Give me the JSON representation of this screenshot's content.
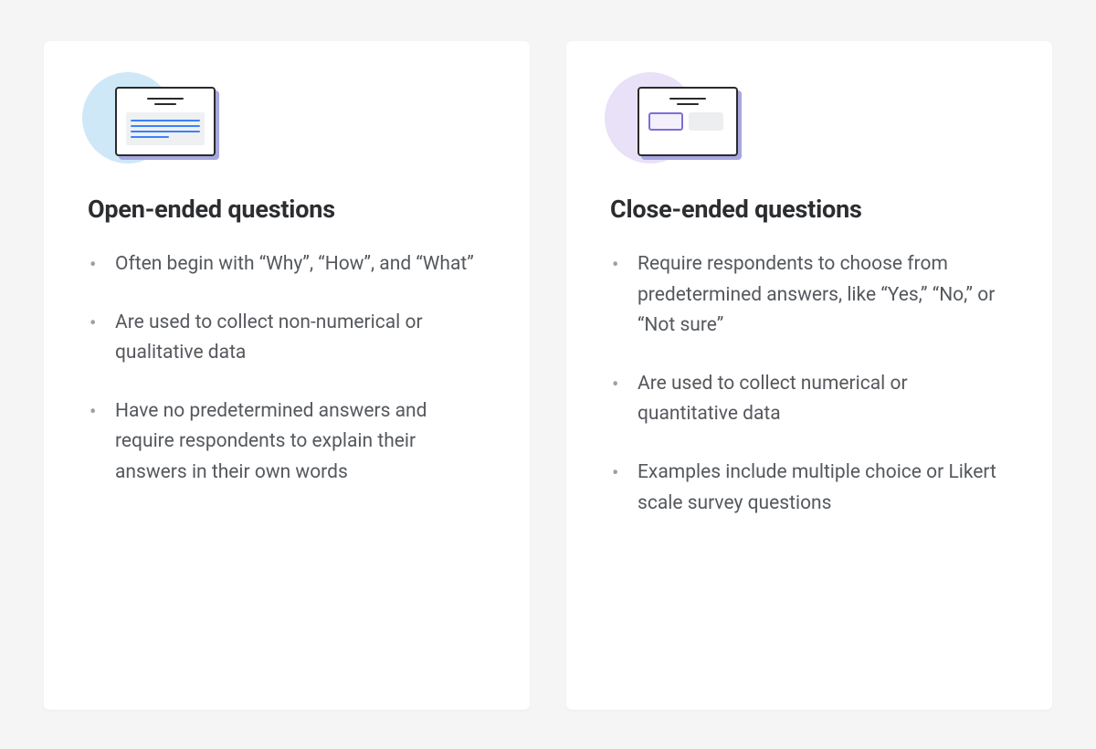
{
  "cards": {
    "open": {
      "title": "Open-ended questions",
      "points": [
        "Often begin with “Why”, “How”, and “What”",
        "Are used to collect non-numerical or qualitative data",
        "Have no predetermined answers and require respondents to explain their answers in their own words"
      ]
    },
    "close": {
      "title": "Close-ended questions",
      "points": [
        "Require respondents to choose from predetermined answers, like “Yes,” “No,” or “Not sure”",
        "Are used to collect numerical or quantitative data",
        "Examples include multiple choice or Likert scale survey questions"
      ]
    }
  }
}
